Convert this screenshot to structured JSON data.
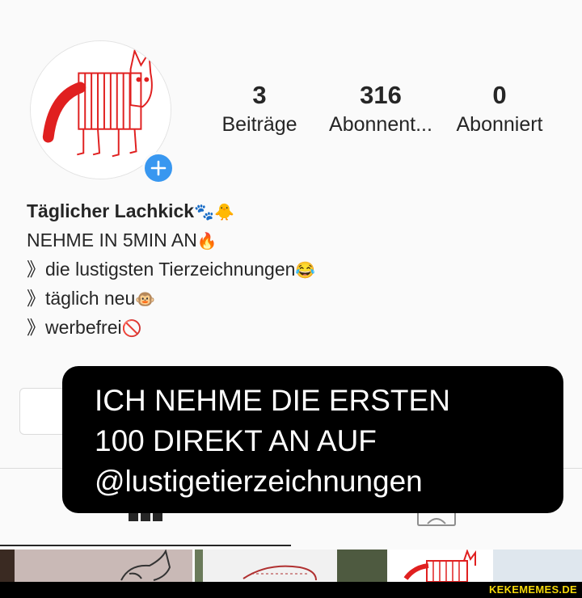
{
  "profile": {
    "stats": [
      {
        "value": "3",
        "label": "Beiträge"
      },
      {
        "value": "316",
        "label": "Abonnent..."
      },
      {
        "value": "0",
        "label": "Abonniert"
      }
    ],
    "name": "Täglicher Lachkick",
    "name_emoji": "🐾🐥",
    "bio_lines": [
      {
        "text": "NEHME IN 5MIN AN",
        "emoji": "🔥"
      },
      {
        "text": "》die lustigsten Tierzeichnungen",
        "emoji": "😂"
      },
      {
        "text": "》täglich neu",
        "emoji": "🐵"
      },
      {
        "text": "》werbefrei",
        "emoji": "🚫"
      }
    ],
    "add_icon": "plus-icon",
    "avatar_image": "red-cat-drawing"
  },
  "overlay": {
    "lines": [
      "ICH NEHME DIE ERSTEN",
      "100 DIREKT AN AUF",
      "@lustigetierzeichnungen"
    ]
  },
  "tabs": [
    {
      "icon": "grid-icon",
      "active": true
    },
    {
      "icon": "tagged-icon",
      "active": false
    }
  ],
  "watermark": "KEKEMEMES.DE",
  "colors": {
    "accent": "#3897f0",
    "overlay_bg": "#000000",
    "watermark": "#f5d90a",
    "drawing": "#e02020"
  }
}
